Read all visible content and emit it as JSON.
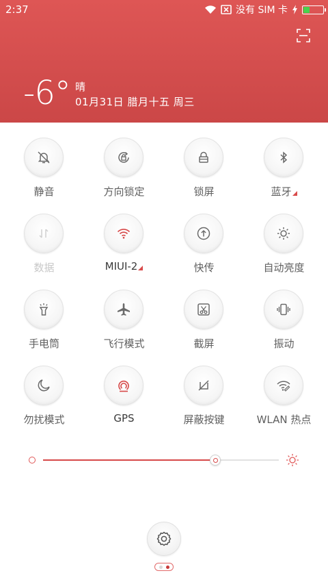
{
  "status_bar": {
    "time": "2:37",
    "carrier": "没有 SIM 卡",
    "battery_level": 0.32,
    "battery_color": "#47d34e",
    "icons": [
      "wifi-icon",
      "sim-blocked-icon",
      "charging-icon",
      "battery-icon"
    ]
  },
  "header": {
    "background": "#d04c4c",
    "temperature": "-6°",
    "weather": "晴",
    "date": "01月31日 腊月十五 周三",
    "expand_icon": "expand-icon"
  },
  "toggles": [
    {
      "label": "静音",
      "icon": "silent-icon",
      "state": "off",
      "menu": false
    },
    {
      "label": "方向锁定",
      "icon": "rotation-lock-icon",
      "state": "off",
      "menu": false
    },
    {
      "label": "锁屏",
      "icon": "lock-screen-icon",
      "state": "off",
      "menu": false
    },
    {
      "label": "蓝牙",
      "icon": "bluetooth-icon",
      "state": "off",
      "menu": true
    },
    {
      "label": "数据",
      "icon": "mobile-data-icon",
      "state": "disabled",
      "menu": false
    },
    {
      "label": "MIUI-2",
      "icon": "wifi-icon",
      "state": "on",
      "menu": true
    },
    {
      "label": "快传",
      "icon": "quick-share-icon",
      "state": "off",
      "menu": false
    },
    {
      "label": "自动亮度",
      "icon": "auto-brightness-icon",
      "state": "off",
      "menu": false
    },
    {
      "label": "手电筒",
      "icon": "flashlight-icon",
      "state": "off",
      "menu": false
    },
    {
      "label": "飞行模式",
      "icon": "airplane-icon",
      "state": "off",
      "menu": false
    },
    {
      "label": "截屏",
      "icon": "screenshot-icon",
      "state": "off",
      "menu": false
    },
    {
      "label": "振动",
      "icon": "vibrate-icon",
      "state": "off",
      "menu": false
    },
    {
      "label": "勿扰模式",
      "icon": "do-not-disturb-icon",
      "state": "off",
      "menu": false
    },
    {
      "label": "GPS",
      "icon": "gps-icon",
      "state": "on",
      "menu": false
    },
    {
      "label": "屏蔽按键",
      "icon": "block-keys-icon",
      "state": "off",
      "menu": false
    },
    {
      "label": "WLAN 热点",
      "icon": "hotspot-icon",
      "state": "off",
      "menu": false
    }
  ],
  "brightness": {
    "level": 0.73,
    "accent": "#d64848",
    "min_icon": "brightness-low-icon",
    "max_icon": "brightness-high-icon"
  },
  "footer": {
    "settings_icon": "gear-icon",
    "pages": 2,
    "current_page": 2
  }
}
